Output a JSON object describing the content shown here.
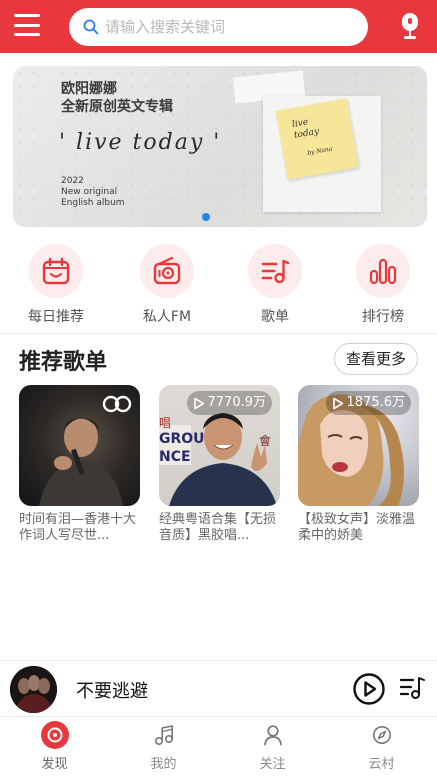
{
  "header": {
    "search_placeholder": "请输入搜索关键词",
    "accent_color": "#e8383d",
    "icons": [
      "menu-icon",
      "search-icon",
      "microphone-icon"
    ]
  },
  "banner": {
    "title_line1": "欧阳娜娜",
    "title_line2": "全新原创英文专辑",
    "handwritten": "' live today '",
    "year": "2022",
    "sub_line1": "New original",
    "sub_line2": "English album",
    "sticky_line1": "live",
    "sticky_line2": "today",
    "sticky_sign": "by Nana",
    "page_indicator": "1"
  },
  "quick_nav": [
    {
      "label": "每日推荐",
      "icon": "calendar-icon"
    },
    {
      "label": "私人FM",
      "icon": "radio-icon"
    },
    {
      "label": "歌单",
      "icon": "playlist-icon"
    },
    {
      "label": "排行榜",
      "icon": "ranking-icon"
    }
  ],
  "recommended": {
    "title": "推荐歌单",
    "more_label": "查看更多",
    "playlists": [
      {
        "title": "时间有泪—香港十大作词人写尽世...",
        "count": ""
      },
      {
        "title": "经典粤语合集【无损音质】黑胶唱...",
        "count": "7770.9万"
      },
      {
        "title": "【极致女声】淡雅温柔中的娇美",
        "count": "1875.6万"
      }
    ]
  },
  "player": {
    "song": "不要逃避"
  },
  "tabbar": [
    {
      "label": "发现",
      "icon": "discover-icon",
      "active": true
    },
    {
      "label": "我的",
      "icon": "music-note-icon",
      "active": false
    },
    {
      "label": "关注",
      "icon": "user-icon",
      "active": false
    },
    {
      "label": "云村",
      "icon": "compass-icon",
      "active": false
    }
  ]
}
